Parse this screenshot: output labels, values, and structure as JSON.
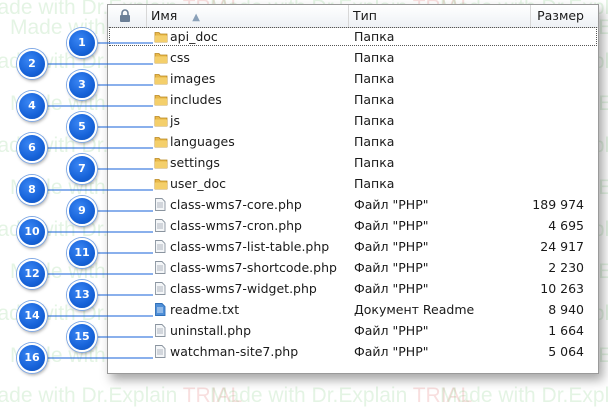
{
  "colors": {
    "accent": "#1662d8",
    "folder": "#e8b84a",
    "selection_outline": "#555555"
  },
  "header": {
    "name_label": "Имя",
    "type_label": "Тип",
    "size_label": "Размер",
    "sort_icon": "sort-ascending-icon",
    "lock_icon": "lock-icon"
  },
  "files": [
    {
      "callout": "1",
      "icon": "folder-icon",
      "name": "api_doc",
      "type": "Папка",
      "size": ""
    },
    {
      "callout": "2",
      "icon": "folder-icon",
      "name": "css",
      "type": "Папка",
      "size": ""
    },
    {
      "callout": "3",
      "icon": "folder-icon",
      "name": "images",
      "type": "Папка",
      "size": ""
    },
    {
      "callout": "4",
      "icon": "folder-icon",
      "name": "includes",
      "type": "Папка",
      "size": ""
    },
    {
      "callout": "5",
      "icon": "folder-icon",
      "name": "js",
      "type": "Папка",
      "size": ""
    },
    {
      "callout": "6",
      "icon": "folder-icon",
      "name": "languages",
      "type": "Папка",
      "size": ""
    },
    {
      "callout": "7",
      "icon": "folder-icon",
      "name": "settings",
      "type": "Папка",
      "size": ""
    },
    {
      "callout": "8",
      "icon": "folder-icon",
      "name": "user_doc",
      "type": "Папка",
      "size": ""
    },
    {
      "callout": "9",
      "icon": "php-file-icon",
      "name": "class-wms7-core.php",
      "type": "Файл \"PHP\"",
      "size": "189 974"
    },
    {
      "callout": "10",
      "icon": "php-file-icon",
      "name": "class-wms7-cron.php",
      "type": "Файл \"PHP\"",
      "size": "4 695"
    },
    {
      "callout": "11",
      "icon": "php-file-icon",
      "name": "class-wms7-list-table.php",
      "type": "Файл \"PHP\"",
      "size": "24 917"
    },
    {
      "callout": "12",
      "icon": "php-file-icon",
      "name": "class-wms7-shortcode.php",
      "type": "Файл \"PHP\"",
      "size": "2 230"
    },
    {
      "callout": "13",
      "icon": "php-file-icon",
      "name": "class-wms7-widget.php",
      "type": "Файл \"PHP\"",
      "size": "10 263"
    },
    {
      "callout": "14",
      "icon": "text-file-icon",
      "name": "readme.txt",
      "type": "Документ Readme",
      "size": "8 940"
    },
    {
      "callout": "15",
      "icon": "php-file-icon",
      "name": "uninstall.php",
      "type": "Файл \"PHP\"",
      "size": "1 664"
    },
    {
      "callout": "16",
      "icon": "php-file-icon",
      "name": "watchman-site7.php",
      "type": "Файл \"PHP\"",
      "size": "5 064"
    }
  ],
  "watermark": {
    "prefix": "Made with Dr.Explain ",
    "suffix": "TRIAL"
  }
}
